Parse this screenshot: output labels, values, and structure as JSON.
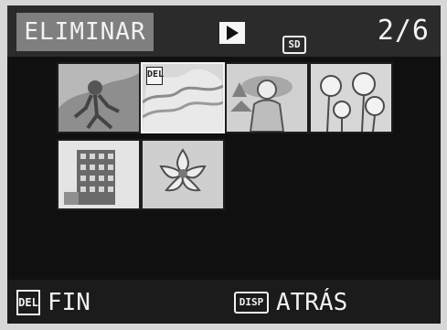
{
  "header": {
    "mode_label": "ELIMINAR",
    "playback_icon": "play-icon",
    "media_icon": "sd-icon",
    "media_icon_text": "SD",
    "counter": "2/6"
  },
  "thumbnails": [
    {
      "subject": "runner",
      "selected": false
    },
    {
      "subject": "clouds",
      "selected": true,
      "marked_icon": "trash-icon",
      "marked_icon_text": "DEL"
    },
    {
      "subject": "woman-in-hat",
      "selected": false
    },
    {
      "subject": "flowers",
      "selected": false
    },
    {
      "subject": "building",
      "selected": false
    },
    {
      "subject": "flower",
      "selected": false
    }
  ],
  "footer": {
    "left_icon": "trash-icon",
    "left_icon_text": "DEL",
    "left_label": "FIN",
    "right_icon": "disp-icon",
    "right_icon_text": "DISP",
    "right_label": "ATRÁS"
  },
  "colors": {
    "body": "#d7d7d7",
    "screen": "#101010",
    "topbar": "#2b2b2b",
    "label_bg": "#7f7f7f",
    "text": "#f2f2f2",
    "selection": "#f3f3f3"
  }
}
